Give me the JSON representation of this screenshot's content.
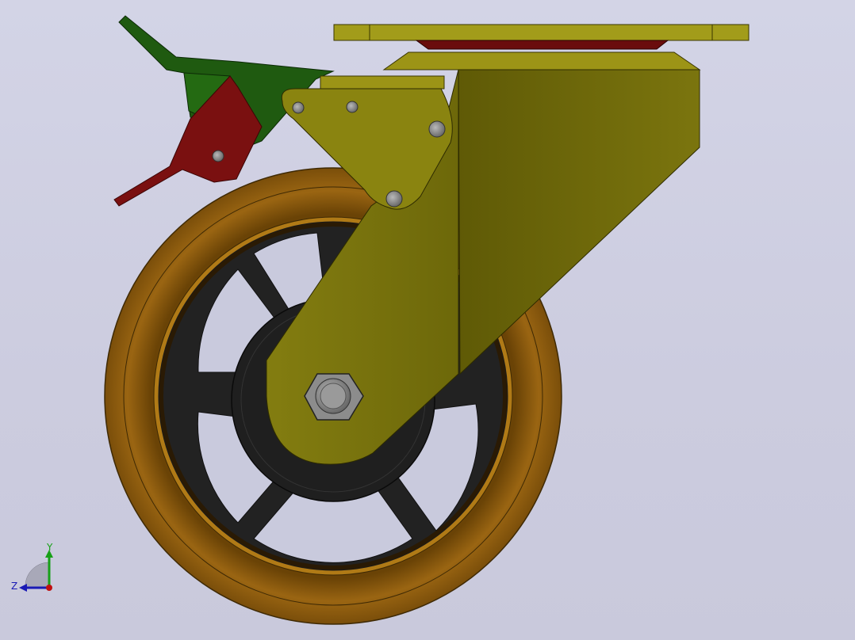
{
  "viewport": {
    "background": "#cfd0e2",
    "colors": {
      "tire": "#8a5a10",
      "tire_light": "#b8801c",
      "tire_dark": "#5a3a06",
      "hub": "#232323",
      "fork_front": "#75700a",
      "fork_side": "#69640a",
      "fork_light": "#9c9416",
      "plate": "#a29c1a",
      "swivel": "#6a0d0d",
      "brake_red": "#7a1010",
      "brake_green": "#1f5a10",
      "bolt": "#8f8f8f"
    }
  },
  "triad": {
    "y_label": "Y",
    "z_label": "Z",
    "colors": {
      "y": "#17a017",
      "z": "#1a1ab5",
      "x": "#c01010"
    }
  }
}
